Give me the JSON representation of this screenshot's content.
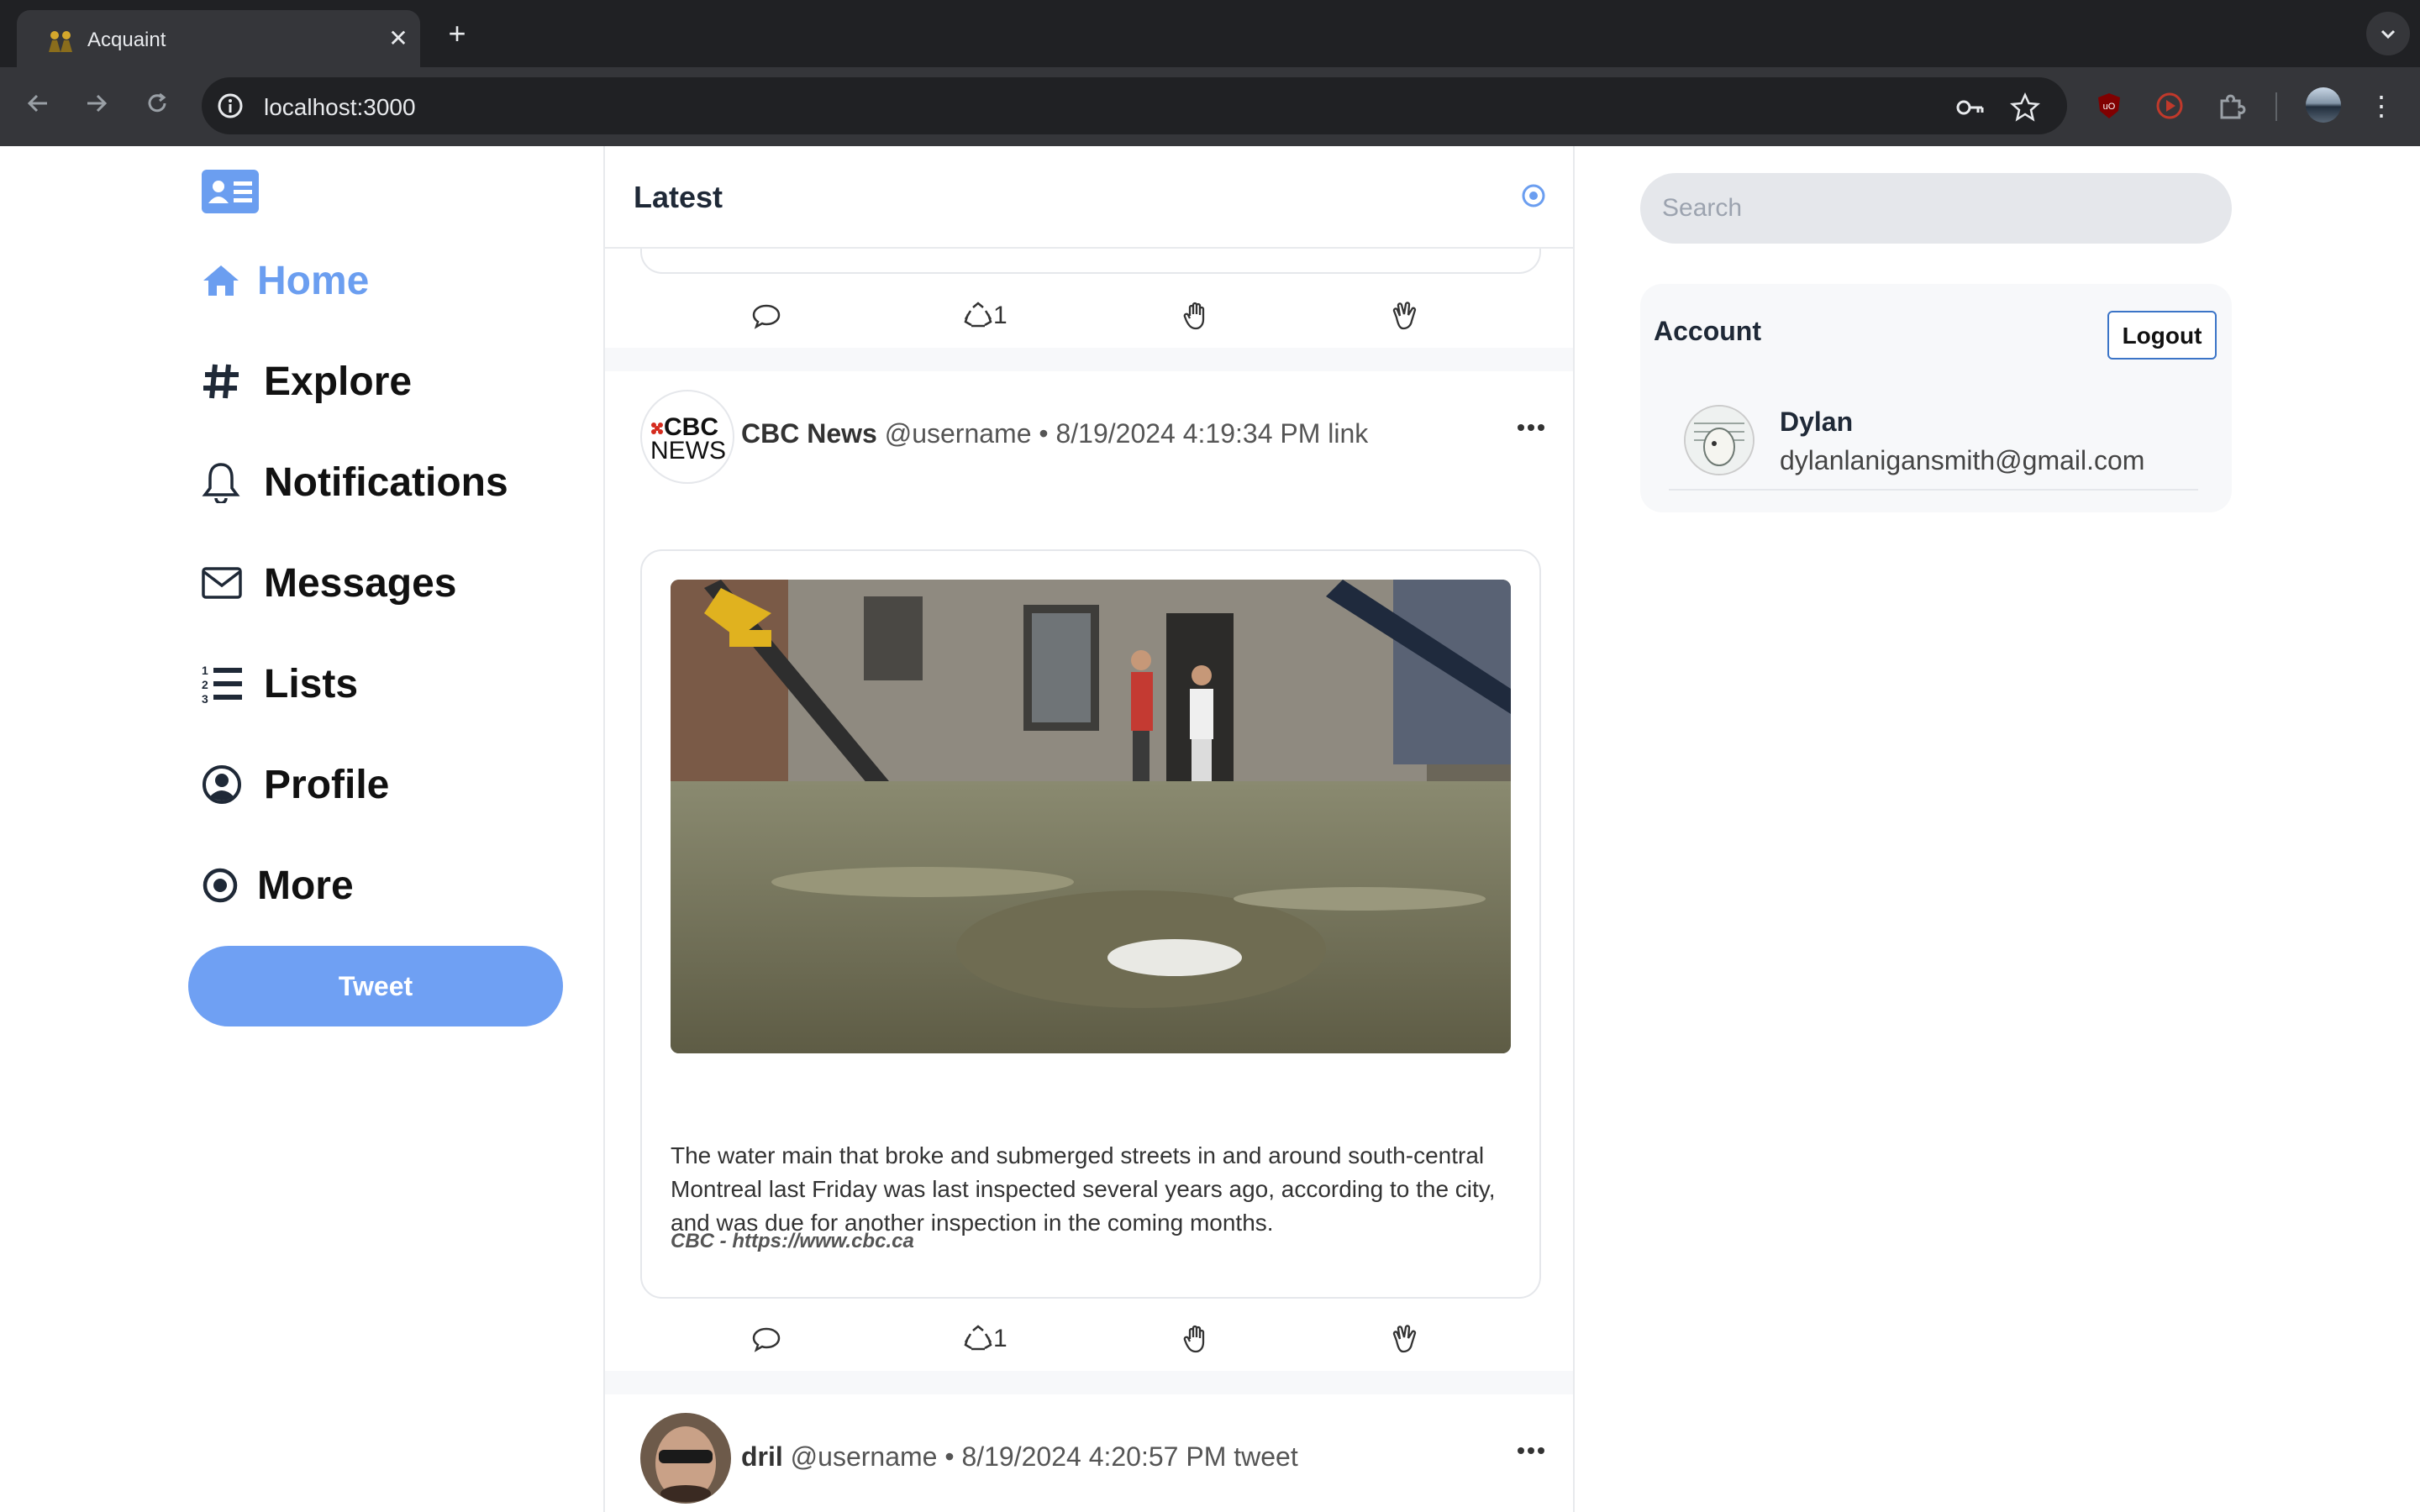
{
  "browser": {
    "tab_title": "Acquaint",
    "url": "localhost:3000",
    "new_tab_symbol": "+",
    "tab_close_symbol": "✕"
  },
  "sidebar": {
    "items": [
      {
        "label": "Home",
        "icon": "home-icon",
        "active": true
      },
      {
        "label": "Explore",
        "icon": "hashtag-icon"
      },
      {
        "label": "Notifications",
        "icon": "bell-icon"
      },
      {
        "label": "Messages",
        "icon": "envelope-icon"
      },
      {
        "label": "Lists",
        "icon": "list-icon"
      },
      {
        "label": "Profile",
        "icon": "user-icon"
      },
      {
        "label": "More",
        "icon": "dot-circle-icon"
      }
    ],
    "tweet_label": "Tweet"
  },
  "feed": {
    "title": "Latest",
    "actions": {
      "repost_count": "1"
    },
    "posts": [
      {
        "name": "CBC News",
        "handle": "@username",
        "separator": "•",
        "timestamp": "8/19/2024 4:19:34 PM",
        "kind": "link",
        "avatar_text_top": "CBC",
        "avatar_text_bottom": "NEWS",
        "link_text": "The water main that broke and submerged streets in and around south-central Montreal last Friday was last inspected several years ago, according to the city, and was due for another inspection in the coming months.",
        "link_source": "CBC - https://www.cbc.ca",
        "repost_count": "1"
      },
      {
        "name": "dril",
        "handle": "@username",
        "separator": "•",
        "timestamp": "8/19/2024 4:20:57 PM",
        "kind": "tweet"
      }
    ]
  },
  "right": {
    "search_placeholder": "Search",
    "account_title": "Account",
    "logout_label": "Logout",
    "user_name": "Dylan",
    "user_email": "dylanlanigansmith@gmail.com"
  },
  "colors": {
    "accent": "#6fa0f3",
    "active_nav": "#6b9ef0",
    "chrome_dark": "#202124",
    "chrome_toolbar": "#35363a"
  }
}
